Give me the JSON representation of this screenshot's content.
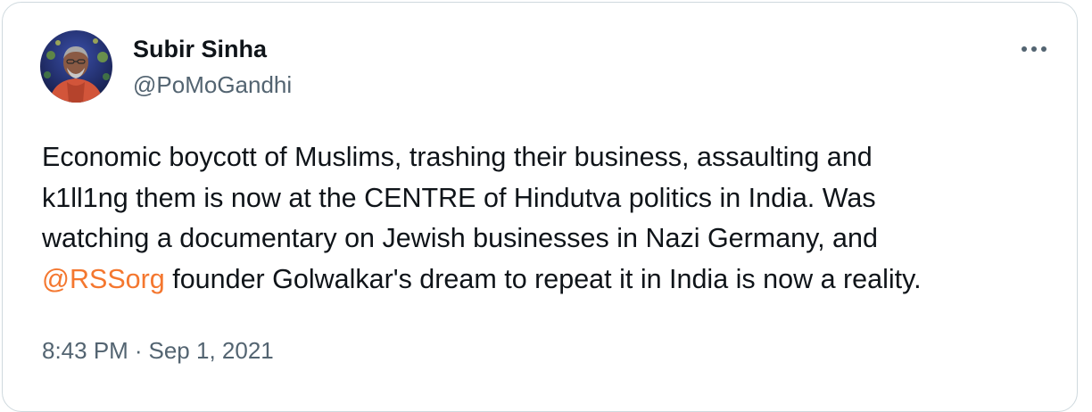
{
  "tweet": {
    "author": {
      "display_name": "Subir Sinha",
      "handle": "@PoMoGandhi",
      "avatar_icon": "profile-photo"
    },
    "more_icon": "ellipsis-horizontal-icon",
    "text_lines": [
      "Economic boycott of Muslims, trashing their business, assaulting and",
      "k1ll1ng them is now at the CENTRE of Hindutva politics in India. Was",
      "watching a documentary on Jewish businesses in Nazi Germany, and"
    ],
    "mention": "@RSSorg",
    "last_line_rest": " founder Golwalkar's dream to repeat it in India is now a reality.",
    "time": "8:43 PM",
    "separator": "·",
    "date": "Sep 1, 2021"
  },
  "colors": {
    "mention": "#f4772f",
    "text": "#0f1419",
    "secondary": "#536471",
    "border": "#cfd9de"
  }
}
